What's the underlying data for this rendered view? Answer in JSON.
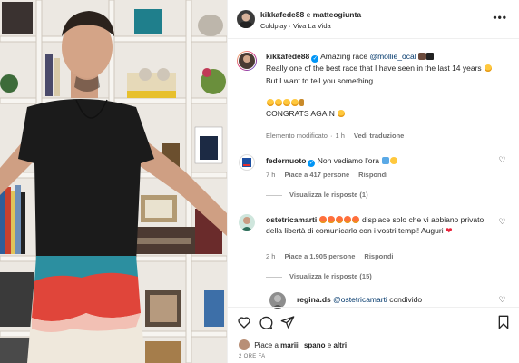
{
  "post": {
    "author": "kikkafede88",
    "conjunction": "e",
    "coauthor": "matteogiunta",
    "song_artist": "Coldplay",
    "song_separator": "·",
    "song_title": "Viva La Vida"
  },
  "caption": {
    "username": "kikkafede88",
    "line1_text": "Amazing race",
    "line1_mention": "@mollie_ocal",
    "line2": "Really one of the best race that I have seen in the last 14 years",
    "line3": "But I want to tell you something.......",
    "line5": "CONGRATS AGAIN",
    "meta_status": "Elemento modificato",
    "meta_time": "1 h",
    "meta_translation": "Vedi traduzione"
  },
  "comments": [
    {
      "username": "federnuoto",
      "text": "Non vediamo l'ora",
      "time": "7 h",
      "likes": "Piace a 417 persone",
      "reply": "Rispondi",
      "view_replies": "Visualizza le risposte (1)"
    },
    {
      "username": "ostetricamarti",
      "text_part1": "dispiace solo che vi abbiano",
      "text_part2": "privato della libertà di comunicarlo con i vostri tempi! Auguri",
      "time": "2 h",
      "likes": "Piace a 1.905 persone",
      "reply": "Rispondi",
      "view_replies": "Visualizza le risposte (15)"
    },
    {
      "username": "regina.ds",
      "mention": "@ostetricamarti",
      "text": "condivido"
    }
  ],
  "footer": {
    "likes_prefix": "Piace a",
    "likes_user": "mariii_spano",
    "likes_conj": "e",
    "likes_others": "altri",
    "date": "2 ORE FA"
  },
  "colors": {
    "verified": "#0095f6",
    "muted": "#737373",
    "text": "#262626"
  },
  "icons": [
    "more-icon",
    "verified-badge-icon",
    "heart-icon",
    "comment-icon",
    "share-icon",
    "bookmark-icon"
  ]
}
